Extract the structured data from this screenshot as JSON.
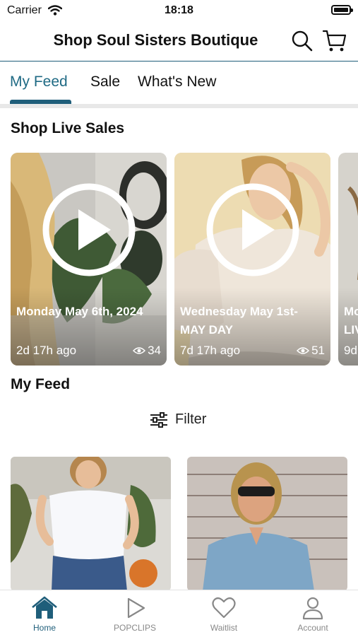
{
  "status_bar": {
    "carrier": "Carrier",
    "time": "18:18"
  },
  "header": {
    "title": "Shop Soul Sisters Boutique",
    "icons": [
      "search-icon",
      "cart-icon"
    ]
  },
  "tabs": [
    {
      "label": "My Feed",
      "active": true
    },
    {
      "label": "Sale",
      "active": false
    },
    {
      "label": "What's New",
      "active": false
    }
  ],
  "live_sales": {
    "title": "Shop Live Sales",
    "cards": [
      {
        "caption": "Monday May 6th, 2024",
        "ago": "2d 17h ago",
        "views": "34"
      },
      {
        "caption": "Wednesday May 1st- MAY DAY",
        "ago": "7d 17h ago",
        "views": "51"
      },
      {
        "caption": "Mo LIV",
        "ago": "9d"
      }
    ]
  },
  "feed": {
    "title": "My Feed",
    "filter_label": "Filter"
  },
  "tab_bar": [
    {
      "label": "Home",
      "icon": "home-icon",
      "active": true
    },
    {
      "label": "POPCLIPS",
      "icon": "play-icon",
      "active": false
    },
    {
      "label": "Waitlist",
      "icon": "heart-icon",
      "active": false
    },
    {
      "label": "Account",
      "icon": "person-icon",
      "active": false
    }
  ],
  "colors": {
    "accent": "#1f5e7a",
    "inactive": "#888888"
  }
}
